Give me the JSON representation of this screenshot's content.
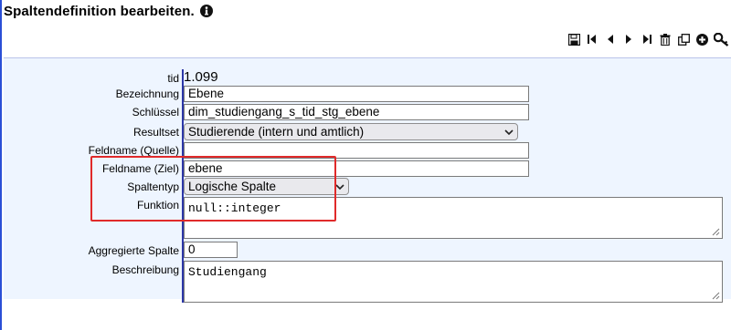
{
  "page": {
    "title": "Spaltendefinition bearbeiten.",
    "info_icon": "info-circle-icon"
  },
  "toolbar": {
    "buttons": [
      "save-icon",
      "first-record-icon",
      "previous-record-icon",
      "next-record-icon",
      "last-record-icon",
      "delete-icon",
      "copy-icon",
      "add-icon",
      "key-icon"
    ]
  },
  "form": {
    "tid": {
      "label": "tid",
      "value": "1.099"
    },
    "bezeichnung": {
      "label": "Bezeichnung",
      "value": "Ebene"
    },
    "schluessel": {
      "label": "Schlüssel",
      "value": "dim_studiengang_s_tid_stg_ebene"
    },
    "resultset": {
      "label": "Resultset",
      "value": "Studierende (intern und amtlich)"
    },
    "feldname_quelle": {
      "label": "Feldname (Quelle)",
      "value": ""
    },
    "feldname_ziel": {
      "label": "Feldname (Ziel)",
      "value": "ebene"
    },
    "spaltentyp": {
      "label": "Spaltentyp",
      "value": "Logische Spalte"
    },
    "funktion": {
      "label": "Funktion",
      "value": "null::integer"
    },
    "aggregierte_spalte": {
      "label": "Aggregierte Spalte",
      "value": "0"
    },
    "beschreibung": {
      "label": "Beschreibung",
      "value": "Studiengang"
    }
  },
  "colors": {
    "highlight": "#e02a2a",
    "panel": "#eef5ff",
    "rule": "#2d38a8"
  }
}
